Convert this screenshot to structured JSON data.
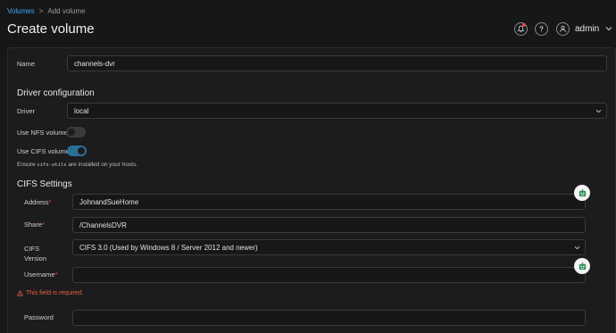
{
  "breadcrumb": {
    "parent": "Volumes",
    "separator": ">",
    "current": "Add volume"
  },
  "page_title": "Create volume",
  "header": {
    "user": "admin"
  },
  "form": {
    "name": {
      "label": "Name",
      "value": "channels-dvr"
    },
    "driver_section_title": "Driver configuration",
    "driver": {
      "label": "Driver",
      "value": "local"
    },
    "nfs_toggle": {
      "label": "Use NFS volume",
      "enabled": false
    },
    "cifs_toggle": {
      "label": "Use CIFS volume",
      "enabled": true
    },
    "cifs_note": {
      "before": "Ensure",
      "code": "cifs-utils",
      "after": "are installed on your hosts."
    },
    "cifs_section_title": "CIFS Settings",
    "address": {
      "label": "Address",
      "value": "JohnandSueHome"
    },
    "share": {
      "label": "Share",
      "value": "/ChannelsDVR"
    },
    "cifs_version": {
      "label_line1": "CIFS",
      "label_line2": "Version",
      "value": "CIFS 3.0 (Used by Windows 8 / Server 2012 and newer)"
    },
    "username": {
      "label": "Username",
      "value": ""
    },
    "username_error": "This field is required.",
    "password": {
      "label": "Password",
      "value": ""
    }
  },
  "colors": {
    "accent_link": "#3ea6ff",
    "required": "#e5484d",
    "error": "#ef5f3b",
    "toggle_on": "#2a6f97"
  }
}
